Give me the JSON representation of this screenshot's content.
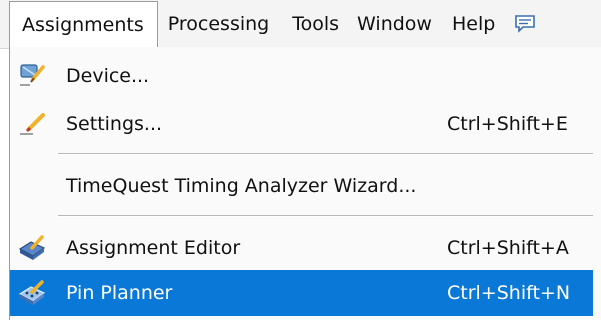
{
  "menubar": {
    "items": [
      "Assignments",
      "Processing",
      "Tools",
      "Window",
      "Help"
    ],
    "active_index": 0,
    "extra_icon": "comment-icon"
  },
  "menu": {
    "items": [
      {
        "label": "Device...",
        "shortcut": "",
        "icon": "device-icon"
      },
      {
        "label": "Settings...",
        "shortcut": "Ctrl+Shift+E",
        "icon": "settings-icon"
      },
      {
        "label": "TimeQuest Timing Analyzer Wizard...",
        "shortcut": "",
        "icon": ""
      },
      {
        "label": "Assignment Editor",
        "shortcut": "Ctrl+Shift+A",
        "icon": "assignment-editor-icon"
      },
      {
        "label": "Pin Planner",
        "shortcut": "Ctrl+Shift+N",
        "icon": "pin-planner-icon"
      }
    ],
    "highlighted_index": 4
  },
  "colors": {
    "highlight": "#0a78d7",
    "menubar_bg": "#f4f4f4",
    "menu_bg": "#fafafa"
  }
}
